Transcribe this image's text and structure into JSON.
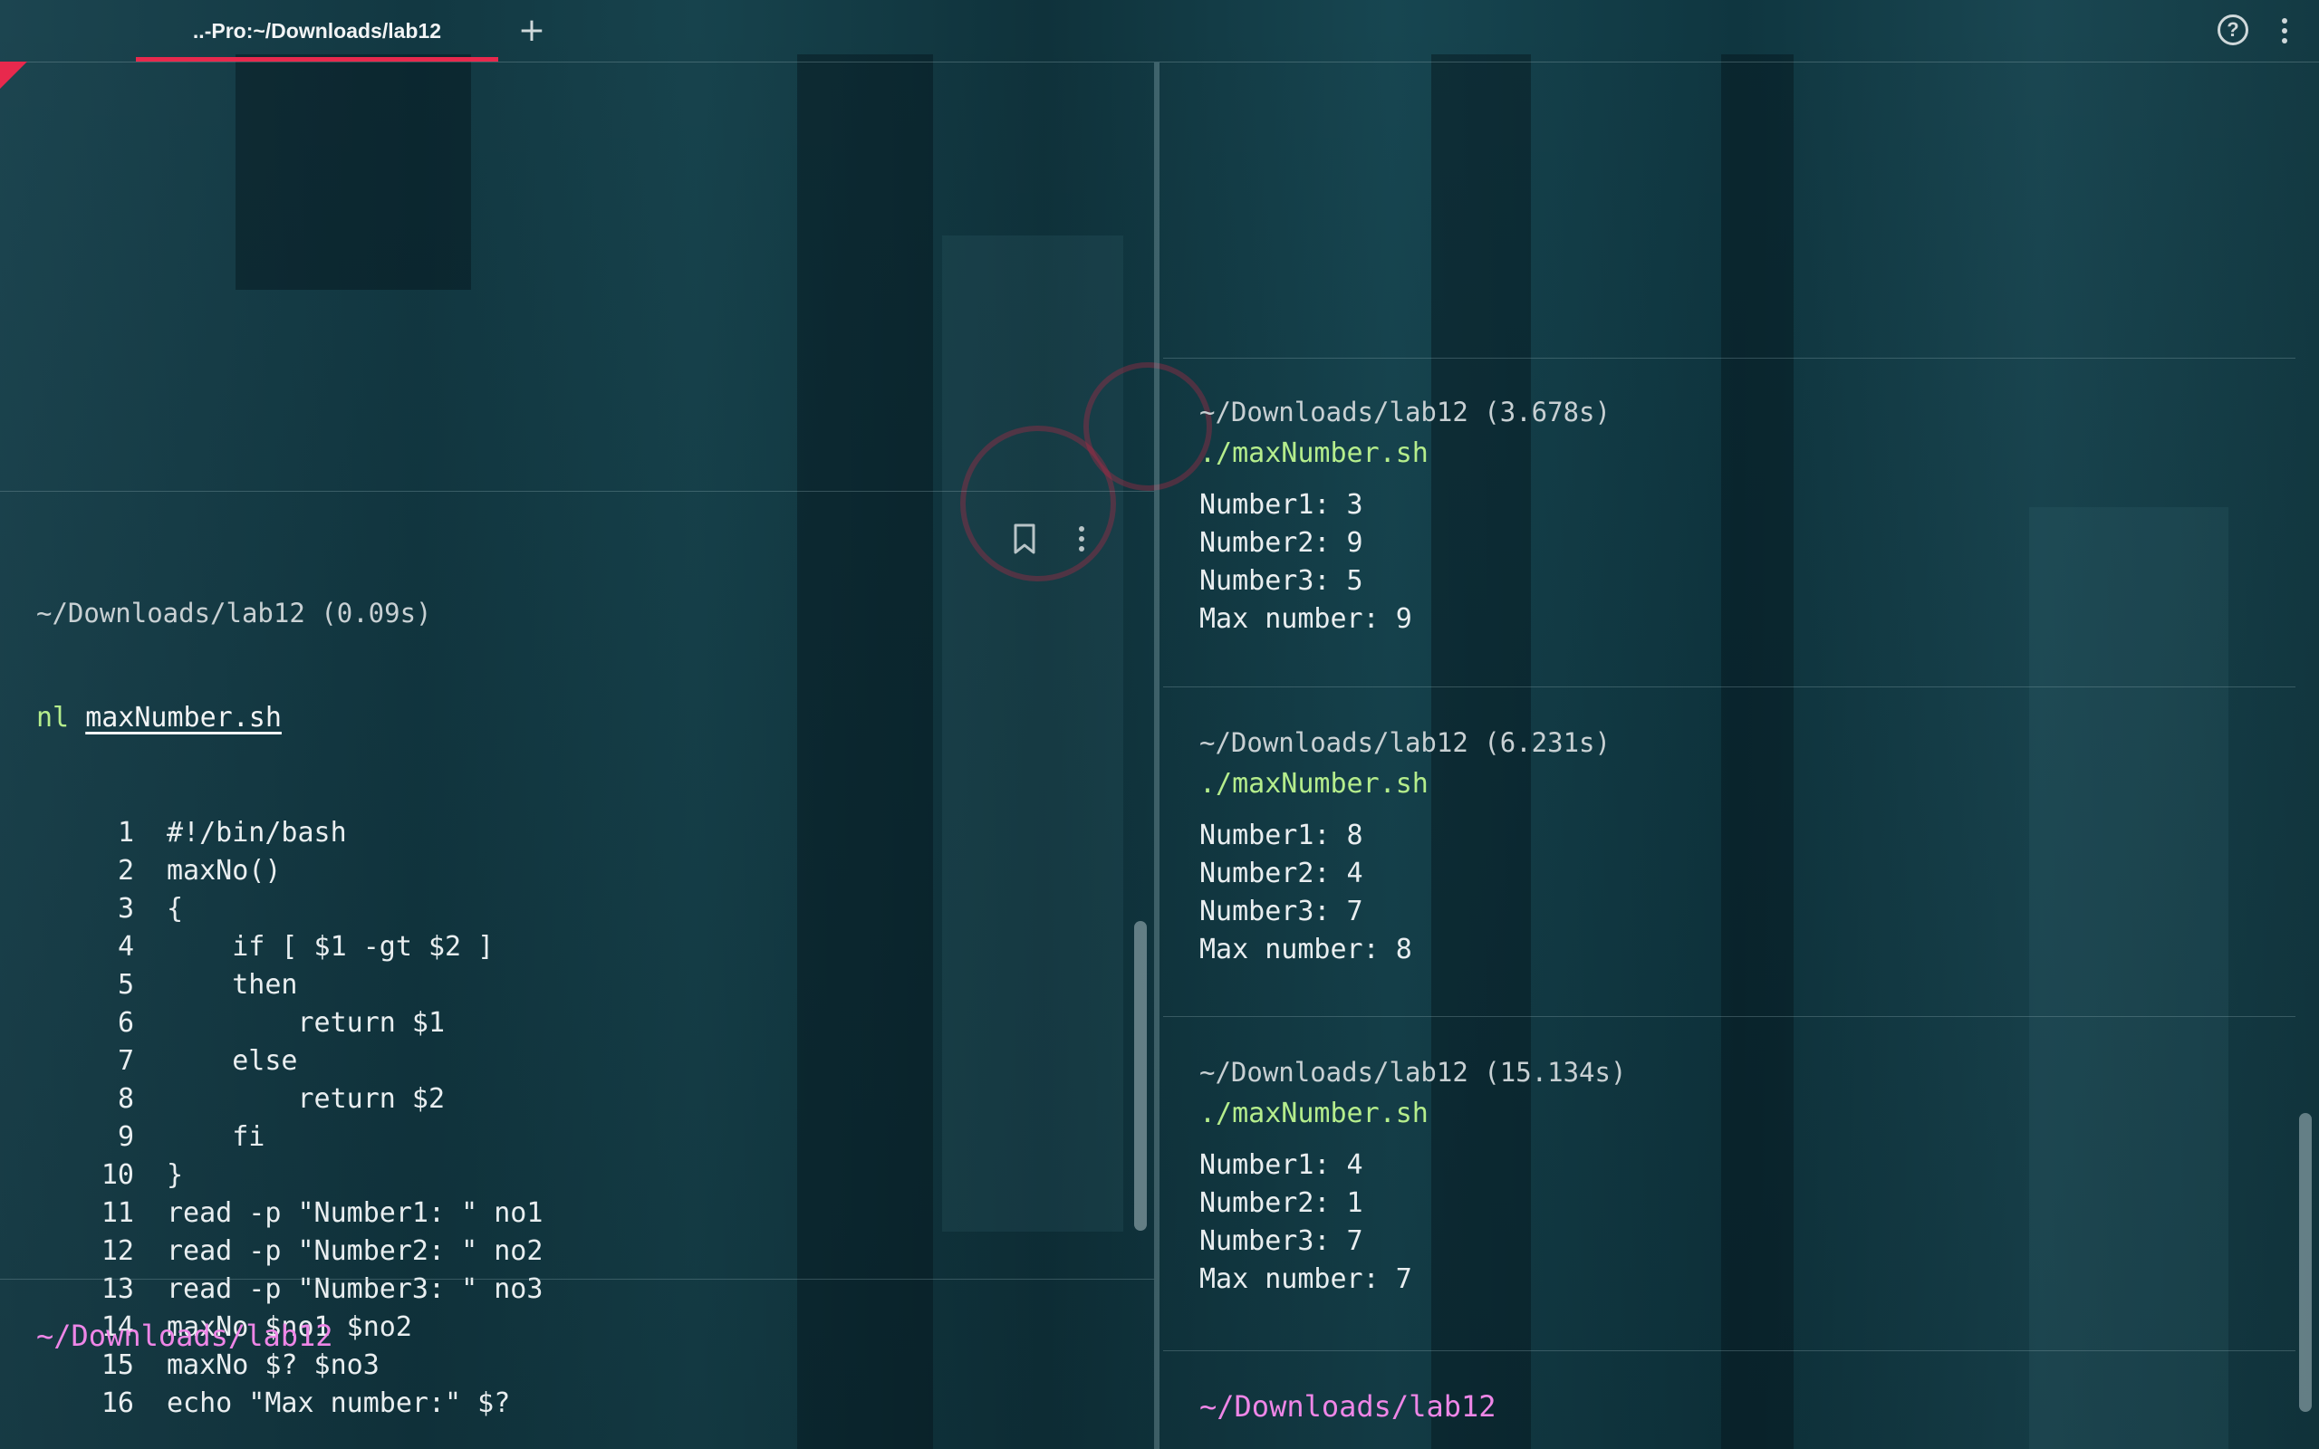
{
  "tab": {
    "title": "..-Pro:~/Downloads/lab12",
    "new_tab_label": "+"
  },
  "toolbar": {
    "help_label": "?"
  },
  "left": {
    "block": {
      "meta": "~/Downloads/lab12 (0.09s)",
      "cmd": "nl",
      "arg": "maxNumber.sh",
      "lines": [
        {
          "n": "1",
          "code": "#!/bin/bash"
        },
        {
          "n": "2",
          "code": "maxNo()"
        },
        {
          "n": "3",
          "code": "{"
        },
        {
          "n": "4",
          "code": "    if [ $1 -gt $2 ]"
        },
        {
          "n": "5",
          "code": "    then"
        },
        {
          "n": "6",
          "code": "        return $1"
        },
        {
          "n": "7",
          "code": "    else"
        },
        {
          "n": "8",
          "code": "        return $2"
        },
        {
          "n": "9",
          "code": "    fi"
        },
        {
          "n": "10",
          "code": "}"
        },
        {
          "n": "11",
          "code": "read -p \"Number1: \" no1"
        },
        {
          "n": "12",
          "code": "read -p \"Number2: \" no2"
        },
        {
          "n": "13",
          "code": "read -p \"Number3: \" no3"
        },
        {
          "n": "14",
          "code": "maxNo $no1 $no2"
        },
        {
          "n": "15",
          "code": "maxNo $? $no3"
        },
        {
          "n": "16",
          "code": "echo \"Max number:\" $?"
        }
      ]
    },
    "prompt": "~/Downloads/lab12"
  },
  "right": {
    "blocks": [
      {
        "meta": "~/Downloads/lab12 (3.678s)",
        "cmd": "./maxNumber.sh",
        "output": [
          "Number1: 3",
          "Number2: 9",
          "Number3: 5",
          "Max number: 9"
        ]
      },
      {
        "meta": "~/Downloads/lab12 (6.231s)",
        "cmd": "./maxNumber.sh",
        "output": [
          "Number1: 8",
          "Number2: 4",
          "Number3: 7",
          "Max number: 8"
        ]
      },
      {
        "meta": "~/Downloads/lab12 (15.134s)",
        "cmd": "./maxNumber.sh",
        "output": [
          "Number1: 4",
          "Number2: 1",
          "Number3: 7",
          "Max number: 7"
        ]
      }
    ],
    "prompt": "~/Downloads/lab12"
  },
  "colors": {
    "accent": "#e8294d",
    "command": "#b5ed8c",
    "prompt": "#ee86e7",
    "text": "#e9eef0",
    "meta": "#c8d0d3"
  },
  "icons": {
    "help": "help-circle-icon",
    "menu": "vertical-dots-icon",
    "bookmark": "bookmark-icon",
    "new_tab": "plus-icon"
  }
}
